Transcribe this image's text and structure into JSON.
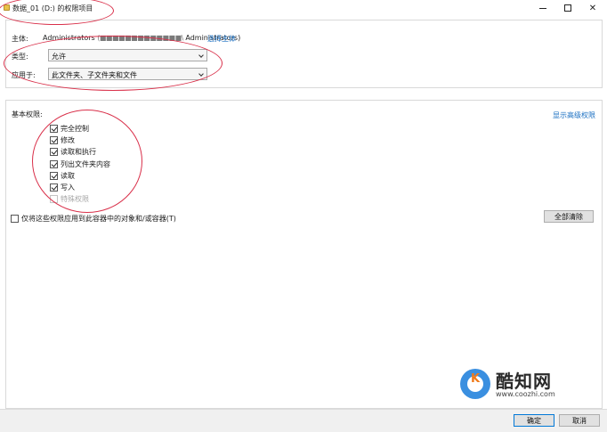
{
  "window": {
    "title": "数据_01 (D:) 的权限项目",
    "controls": {
      "minimize": "minimize",
      "maximize": "maximize",
      "close": "✕"
    }
  },
  "principal": {
    "label": "主体:",
    "value_prefix": "Administrators",
    "value_obscured": "(■■■■■■■■■■■■■\\",
    "value_suffix": "Administrators)",
    "select_link": "选择主体"
  },
  "type": {
    "label": "类型:",
    "value": "允许"
  },
  "applies_to": {
    "label": "应用于:",
    "value": "此文件夹、子文件夹和文件"
  },
  "basic_permissions": {
    "label": "基本权限:",
    "show_advanced_link": "显示高级权限",
    "items": [
      {
        "label": "完全控制",
        "checked": true,
        "disabled": false
      },
      {
        "label": "修改",
        "checked": true,
        "disabled": false
      },
      {
        "label": "读取和执行",
        "checked": true,
        "disabled": false
      },
      {
        "label": "列出文件夹内容",
        "checked": true,
        "disabled": false
      },
      {
        "label": "读取",
        "checked": true,
        "disabled": false
      },
      {
        "label": "写入",
        "checked": true,
        "disabled": false
      },
      {
        "label": "特殊权限",
        "checked": false,
        "disabled": true
      }
    ]
  },
  "apply_only": {
    "label": "仅将这些权限应用到此容器中的对象和/或容器(T)",
    "checked": false
  },
  "buttons": {
    "clear_all": "全部清除",
    "ok": "确定",
    "cancel": "取消"
  },
  "watermark": {
    "name": "酷知网",
    "url": "www.coozhi.com",
    "logo_letter": "K"
  },
  "colors": {
    "link": "#1a6fc2",
    "annotation": "#d9304a",
    "ok_border": "#0078d7"
  }
}
